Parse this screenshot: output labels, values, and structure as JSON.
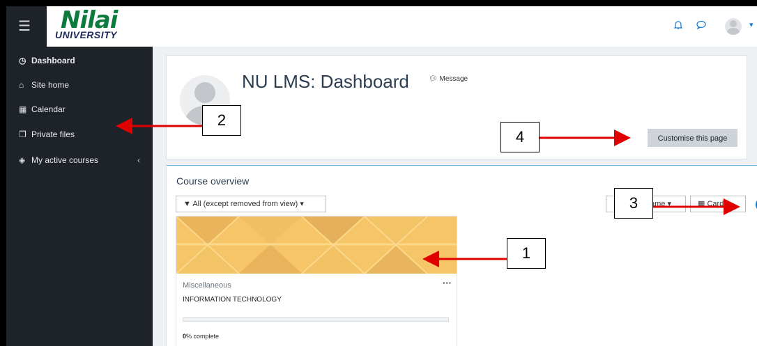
{
  "brand": {
    "logo_main": "Nilai",
    "logo_sub": "UNIVERSITY",
    "accent": "#1177d1",
    "logo_green": "#0d7a3e"
  },
  "topbar": {
    "menu_icon": "hamburger-icon",
    "icons": [
      "bell-icon",
      "chat-icon",
      "user-avatar-icon"
    ]
  },
  "sidebar": {
    "items": [
      {
        "label": "Dashboard",
        "icon": "gauge-icon"
      },
      {
        "label": "Site home",
        "icon": "home-icon"
      },
      {
        "label": "Calendar",
        "icon": "calendar-icon"
      },
      {
        "label": "Private files",
        "icon": "files-icon"
      },
      {
        "label": "My active courses",
        "icon": "graduation-cap-icon"
      }
    ]
  },
  "header": {
    "title": "NU LMS: Dashboard",
    "message_label": "Message",
    "customise_label": "Customise this page"
  },
  "overview": {
    "title": "Course overview",
    "filter_label": "All (except removed from view)",
    "sort_label": "ame",
    "view_label": "Card"
  },
  "course": {
    "category": "Miscellaneous",
    "name": "INFORMATION TECHNOLOGY",
    "menu": "···",
    "progress_value": "0",
    "progress_suffix": "% complete",
    "progress_fraction": 0
  },
  "annotations": {
    "c1": "1",
    "c2": "2",
    "c3": "3",
    "c4": "4",
    "arrow_color": "#e00000"
  }
}
